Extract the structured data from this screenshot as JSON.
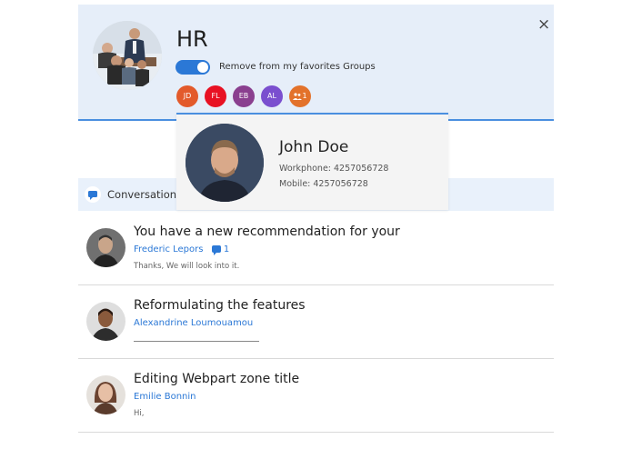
{
  "group": {
    "title": "HR",
    "favorite_toggle_label": "Remove from my favorites Groups",
    "favorite_toggle_on": true,
    "members": [
      {
        "initials": "JD",
        "color": "#e35a2b"
      },
      {
        "initials": "FL",
        "color": "#e81123"
      },
      {
        "initials": "EB",
        "color": "#8a3f8f"
      },
      {
        "initials": "AL",
        "color": "#7a4fcf"
      }
    ],
    "more_members": {
      "count": "1",
      "color": "#e3722b",
      "icon": "people-icon"
    },
    "close_icon": "close-icon",
    "close_glyph": "×"
  },
  "contact_card": {
    "name": "John Doe",
    "workphone": "Workphone: 4257056728",
    "mobile": "Mobile: 4257056728"
  },
  "conversations": {
    "label": "Conversation",
    "icon": "chat-bubble-icon",
    "items": [
      {
        "title": "You have a new recommendation for your",
        "author": "Frederic Lepors",
        "reply_count": "1",
        "snippet": "Thanks, We will look into it."
      },
      {
        "title": "Reformulating the features",
        "author": "Alexandrine Loumouamou",
        "reply_count": "",
        "snippet": ""
      },
      {
        "title": "Editing Webpart zone title",
        "author": "Emilie Bonnin",
        "reply_count": "",
        "snippet": "Hi,"
      }
    ]
  },
  "colors": {
    "accent": "#2b78d6",
    "header_bg": "#e6eef9",
    "conversation_bar_bg": "#e9f1fb"
  }
}
